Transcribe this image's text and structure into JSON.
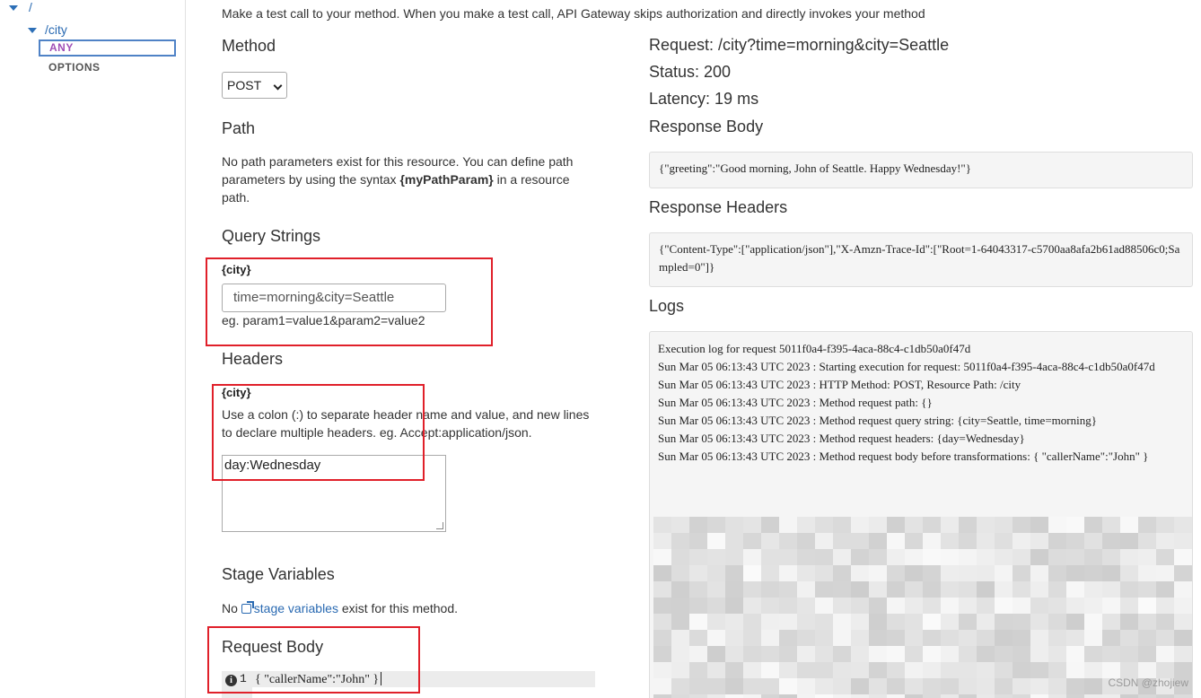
{
  "tree": {
    "root": "/",
    "city": "/city",
    "methods": [
      "ANY",
      "OPTIONS"
    ]
  },
  "intro": "Make a test call to your method. When you make a test call, API Gateway skips authorization and directly invokes your method",
  "method": {
    "heading": "Method",
    "selected": "POST"
  },
  "path": {
    "heading": "Path",
    "text_before": "No path parameters exist for this resource. You can define path parameters by using the syntax ",
    "syntax": "{myPathParam}",
    "text_after": " in a resource path."
  },
  "query_strings": {
    "heading": "Query Strings",
    "label": "{city}",
    "value": "time=morning&city=Seattle",
    "hint": "eg. param1=value1&param2=value2"
  },
  "headers": {
    "heading": "Headers",
    "label": "{city}",
    "help": "Use a colon (:) to separate header name and value, and new lines to declare multiple headers. eg. Accept:application/json.",
    "value": "day:Wednesday"
  },
  "stage_variables": {
    "heading": "Stage Variables",
    "prefix": "No ",
    "link": "stage variables",
    "suffix": " exist for this method."
  },
  "request_body": {
    "heading": "Request Body",
    "line_number": "1",
    "code": "{ \"callerName\":\"John\" }"
  },
  "result": {
    "request": "Request: /city?time=morning&city=Seattle",
    "status": "Status: 200",
    "latency": "Latency: 19 ms",
    "response_body_heading": "Response Body",
    "response_body": "{\"greeting\":\"Good morning, John of Seattle. Happy Wednesday!\"}",
    "response_headers_heading": "Response Headers",
    "response_headers": "{\"Content-Type\":[\"application/json\"],\"X-Amzn-Trace-Id\":[\"Root=1-64043317-c5700aa8afa2b61ad88506c0;Sampled=0\"]}",
    "logs_heading": "Logs",
    "logs": [
      "Execution log for request 5011f0a4-f395-4aca-88c4-c1db50a0f47d",
      "Sun Mar 05 06:13:43 UTC 2023 : Starting execution for request: 5011f0a4-f395-4aca-88c4-c1db50a0f47d",
      "Sun Mar 05 06:13:43 UTC 2023 : HTTP Method: POST, Resource Path: /city",
      "Sun Mar 05 06:13:43 UTC 2023 : Method request path: {}",
      "Sun Mar 05 06:13:43 UTC 2023 : Method request query string: {city=Seattle, time=morning}",
      "Sun Mar 05 06:13:43 UTC 2023 : Method request headers: {day=Wednesday}",
      "Sun Mar 05 06:13:43 UTC 2023 : Method request body before transformations: { \"callerName\":\"John\" }"
    ]
  },
  "watermark": "CSDN @zhojiew"
}
